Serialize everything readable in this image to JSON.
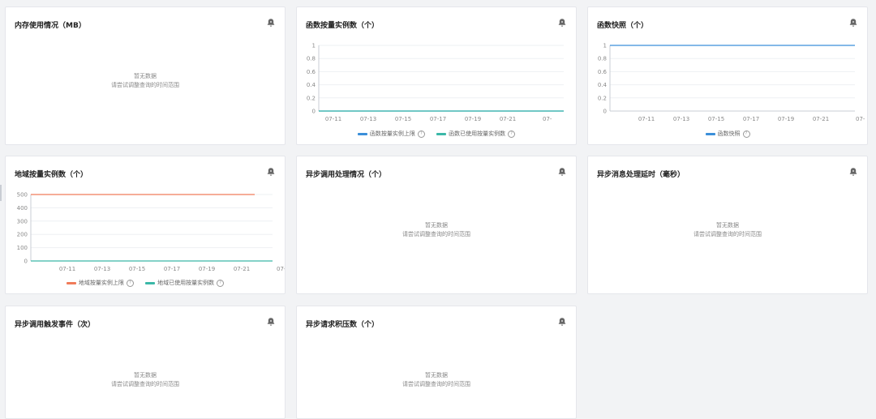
{
  "empty": {
    "line1": "暂无数据",
    "line2": "请尝试调整查询的时间范围"
  },
  "cards": {
    "memory": {
      "title": "内存使用情况（MB）"
    },
    "func_quota": {
      "title": "函数按量实例数（个）",
      "legend": [
        "函数按量实例上限",
        "函数已使用按量实例数"
      ]
    },
    "func_snapshot": {
      "title": "函数快照（个）",
      "legend": [
        "函数快照"
      ]
    },
    "region_quota": {
      "title": "地域按量实例数（个）",
      "legend": [
        "地域按量实例上限",
        "地域已使用按量实例数"
      ]
    },
    "async_invoke": {
      "title": "异步调用处理情况（个）"
    },
    "async_latency": {
      "title": "异步消息处理延时（毫秒）"
    },
    "async_trigger": {
      "title": "异步调用触发事件（次）"
    },
    "async_backlog": {
      "title": "异步请求积压数（个）"
    }
  },
  "colors": {
    "blue": "#3b8fd9",
    "teal": "#3bb8a8",
    "orange": "#f07c5a",
    "grid": "#eef0f3",
    "axis": "#c9cdd4"
  },
  "chart_data": [
    {
      "type": "line",
      "title": "函数按量实例数（个）",
      "x": [
        "07-11",
        "07-13",
        "07-15",
        "07-17",
        "07-19",
        "07-21",
        "07-"
      ],
      "ylim": [
        0,
        1
      ],
      "yticks": [
        "0",
        "0.2",
        "0.4",
        "0.6",
        "0.8",
        "1"
      ],
      "series": [
        {
          "name": "函数按量实例上限",
          "color": "#3b8fd9",
          "values": [
            0,
            0,
            0,
            0,
            0,
            0,
            0
          ]
        },
        {
          "name": "函数已使用按量实例数",
          "color": "#3bb8a8",
          "values": [
            0,
            0,
            0,
            0,
            0,
            0,
            0
          ]
        }
      ]
    },
    {
      "type": "line",
      "title": "函数快照（个）",
      "x": [
        "07-11",
        "07-13",
        "07-15",
        "07-17",
        "07-19",
        "07-21",
        "07-"
      ],
      "ylim": [
        0,
        1
      ],
      "yticks": [
        "0",
        "0.2",
        "0.4",
        "0.6",
        "0.8",
        "1"
      ],
      "series": [
        {
          "name": "函数快照",
          "color": "#3b8fd9",
          "values": [
            1,
            1,
            1,
            1,
            1,
            1,
            1
          ]
        }
      ]
    },
    {
      "type": "line",
      "title": "地域按量实例数（个）",
      "x": [
        "07-11",
        "07-13",
        "07-15",
        "07-17",
        "07-19",
        "07-21",
        "07-"
      ],
      "ylim": [
        0,
        500
      ],
      "yticks": [
        "0",
        "100",
        "200",
        "300",
        "400",
        "500"
      ],
      "series": [
        {
          "name": "地域按量实例上限",
          "color": "#f07c5a",
          "values": [
            500,
            500,
            500,
            500,
            500,
            500,
            null
          ]
        },
        {
          "name": "地域已使用按量实例数",
          "color": "#3bb8a8",
          "values": [
            0,
            0,
            0,
            0,
            0,
            0,
            0
          ]
        }
      ]
    }
  ]
}
